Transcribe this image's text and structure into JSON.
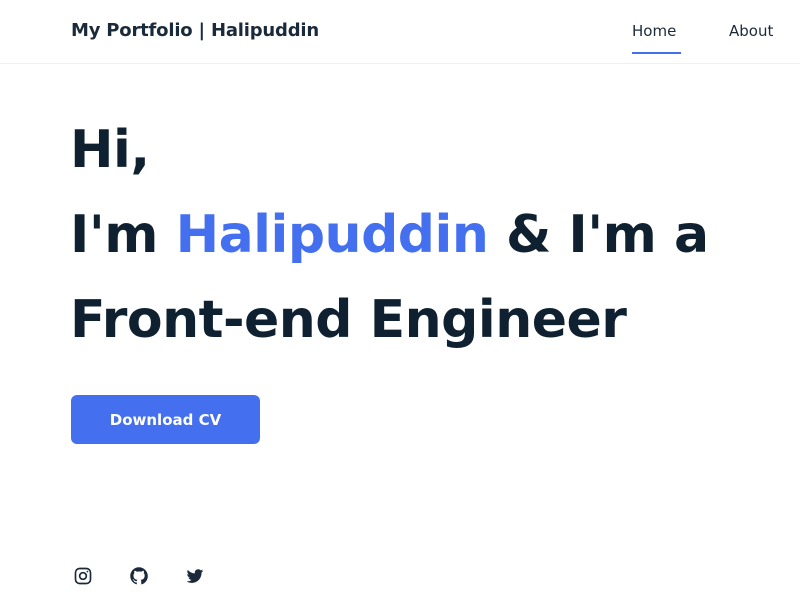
{
  "navbar": {
    "brand": "My Portfolio | Halipuddin",
    "links": [
      {
        "label": "Home",
        "active": true
      },
      {
        "label": "About",
        "active": false
      }
    ]
  },
  "hero": {
    "line1": "Hi,",
    "line2_prefix": "I'm ",
    "line2_name": "Halipuddin",
    "line2_suffix": " & I'm a",
    "line3": "Front-end Engineer"
  },
  "cta": {
    "label": "Download CV"
  },
  "social": [
    {
      "icon": "instagram-icon"
    },
    {
      "icon": "github-icon"
    },
    {
      "icon": "twitter-icon"
    }
  ],
  "colors": {
    "accent": "#4470f0",
    "text": "#0f2131",
    "background": "#ffffff"
  }
}
